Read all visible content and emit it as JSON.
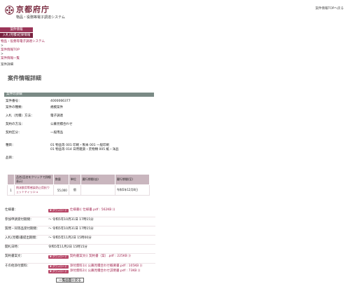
{
  "header": {
    "logo_title": "京都府庁",
    "logo_subtitle": "物品・役務等電子調達システム",
    "top_link": "案件情報TOPへ戻る"
  },
  "nav": [
    "案件情報",
    "入札(見積)結果情報"
  ],
  "breadcrumb": {
    "items": [
      "物品・役務等電子調達システム",
      "案件情報TOP",
      "案件情報一覧"
    ],
    "separator": ">",
    "current": "案件詳細"
  },
  "page_title": "案件情報詳細",
  "section_title": "案件の詳細",
  "details": [
    {
      "label": "案件番号：",
      "value": "4000066377"
    },
    {
      "label": "案件の種類：",
      "value": "規模案件"
    },
    {
      "label": "入札（見積）方法：",
      "value": "電子調達"
    },
    {
      "label": "契約の方法：",
      "value": "公募見積合わせ"
    },
    {
      "label": "契約区分：",
      "value": "一般用品"
    }
  ],
  "species": {
    "label": "種目：",
    "values": [
      "01 物品等 001 印刷・製本 001 一般印刷",
      "01 物品等 014 日用雑貨・荒物類 005 紙・洋品"
    ]
  },
  "item_name_label": "品目：",
  "items_table": {
    "headers": [
      "",
      "品名(品名をクリックで詳細表示)",
      "数量",
      "単位",
      "履行期間(自)",
      "履行期間(至)"
    ],
    "rows": [
      {
        "no": "1",
        "name": "飛沫飲用等感染防止用抗ウェットティッシュ",
        "qty": "55,000",
        "unit": "個",
        "from": "",
        "to": "令和5年12月8日"
      }
    ]
  },
  "spec_files": {
    "label": "仕様書：",
    "badge": "ダウンロード",
    "file": "仕様書(( 仕様書.pdf : 562KB ))"
  },
  "deadlines": [
    {
      "label": "参加申請受付期間：",
      "value": "～ 令和5年10月31日 17時15分"
    },
    {
      "label": "質問・同等品受付期間：",
      "value": "～ 令和5年10月31日 17時15分"
    },
    {
      "label": "入札(見積)書提出期間：",
      "value": "～ 令和5年11月2日 15時00分"
    },
    {
      "label": "開札日時：",
      "value": "令和5年11月2日 15時15分"
    }
  ],
  "contract_files": {
    "label": "契約書案文：",
    "badge": "ダウンロード",
    "file": "契約書案文(( 契約書（案）.pdf : 225KB ))"
  },
  "other_files": {
    "label": "その他添付資料：",
    "badge": "ダウンロード",
    "files": [
      "添付資料1(( 公募見積合わせ概要書.pdf : 105KB ))",
      "添付資料2(( 公募見積合わせ説明書.pdf : 73KB ))"
    ]
  },
  "back_button": "一覧画面に戻る",
  "colors": {
    "brand": "#7a2a3f",
    "nav": "#9a3558",
    "section_header": "#7a8a85",
    "table_header": "#c9b6be"
  }
}
